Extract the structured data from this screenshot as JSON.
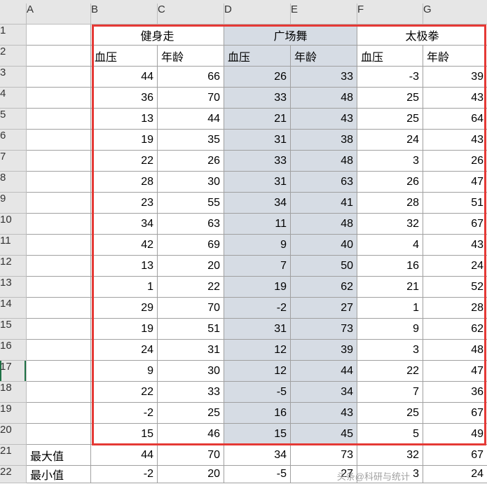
{
  "columns": [
    "A",
    "B",
    "C",
    "D",
    "E",
    "F",
    "G"
  ],
  "row_headers": [
    "1",
    "2",
    "3",
    "4",
    "5",
    "6",
    "7",
    "8",
    "9",
    "10",
    "11",
    "12",
    "13",
    "14",
    "15",
    "16",
    "17",
    "18",
    "19",
    "20",
    "21",
    "22"
  ],
  "groups": [
    {
      "label": "健身走",
      "sub": [
        "血压",
        "年龄"
      ]
    },
    {
      "label": "广场舞",
      "sub": [
        "血压",
        "年龄"
      ]
    },
    {
      "label": "太极拳",
      "sub": [
        "血压",
        "年龄"
      ]
    }
  ],
  "rows": [
    {
      "b": "44",
      "c": "66",
      "d": "26",
      "e": "33",
      "f": "-3",
      "g": "39"
    },
    {
      "b": "36",
      "c": "70",
      "d": "33",
      "e": "48",
      "f": "25",
      "g": "43"
    },
    {
      "b": "13",
      "c": "44",
      "d": "21",
      "e": "43",
      "f": "25",
      "g": "64"
    },
    {
      "b": "19",
      "c": "35",
      "d": "31",
      "e": "38",
      "f": "24",
      "g": "43"
    },
    {
      "b": "22",
      "c": "26",
      "d": "33",
      "e": "48",
      "f": "3",
      "g": "26"
    },
    {
      "b": "28",
      "c": "30",
      "d": "31",
      "e": "63",
      "f": "26",
      "g": "47"
    },
    {
      "b": "23",
      "c": "55",
      "d": "34",
      "e": "41",
      "f": "28",
      "g": "51"
    },
    {
      "b": "34",
      "c": "63",
      "d": "11",
      "e": "48",
      "f": "32",
      "g": "67"
    },
    {
      "b": "42",
      "c": "69",
      "d": "9",
      "e": "40",
      "f": "4",
      "g": "43"
    },
    {
      "b": "13",
      "c": "20",
      "d": "7",
      "e": "50",
      "f": "16",
      "g": "24"
    },
    {
      "b": "1",
      "c": "22",
      "d": "19",
      "e": "62",
      "f": "21",
      "g": "52"
    },
    {
      "b": "29",
      "c": "70",
      "d": "-2",
      "e": "27",
      "f": "1",
      "g": "28"
    },
    {
      "b": "19",
      "c": "51",
      "d": "31",
      "e": "73",
      "f": "9",
      "g": "62"
    },
    {
      "b": "24",
      "c": "31",
      "d": "12",
      "e": "39",
      "f": "3",
      "g": "48"
    },
    {
      "b": "9",
      "c": "30",
      "d": "12",
      "e": "44",
      "f": "22",
      "g": "47"
    },
    {
      "b": "22",
      "c": "33",
      "d": "-5",
      "e": "34",
      "f": "7",
      "g": "36"
    },
    {
      "b": "-2",
      "c": "25",
      "d": "16",
      "e": "43",
      "f": "25",
      "g": "67"
    },
    {
      "b": "15",
      "c": "46",
      "d": "15",
      "e": "45",
      "f": "5",
      "g": "49"
    }
  ],
  "summary": [
    {
      "label": "最大值",
      "b": "44",
      "c": "70",
      "d": "34",
      "e": "73",
      "f": "32",
      "g": "67"
    },
    {
      "label": "最小值",
      "b": "-2",
      "c": "20",
      "d": "-5",
      "e": "27",
      "f": "3",
      "g": "24"
    }
  ],
  "watermark": "头条@科研与统计",
  "chart_data": {
    "type": "table",
    "title": "",
    "series": [
      {
        "name": "健身走-血压",
        "values": [
          44,
          36,
          13,
          19,
          22,
          28,
          23,
          34,
          42,
          13,
          1,
          29,
          19,
          24,
          9,
          22,
          -2,
          15
        ]
      },
      {
        "name": "健身走-年龄",
        "values": [
          66,
          70,
          44,
          35,
          26,
          30,
          55,
          63,
          69,
          20,
          22,
          70,
          51,
          31,
          30,
          33,
          25,
          46
        ]
      },
      {
        "name": "广场舞-血压",
        "values": [
          26,
          33,
          21,
          31,
          33,
          31,
          34,
          11,
          9,
          7,
          19,
          -2,
          31,
          12,
          12,
          -5,
          16,
          15
        ]
      },
      {
        "name": "广场舞-年龄",
        "values": [
          33,
          48,
          43,
          38,
          48,
          63,
          41,
          48,
          40,
          50,
          62,
          27,
          73,
          39,
          44,
          34,
          43,
          45
        ]
      },
      {
        "name": "太极拳-血压",
        "values": [
          -3,
          25,
          25,
          24,
          3,
          26,
          28,
          32,
          4,
          16,
          21,
          1,
          9,
          3,
          22,
          7,
          25,
          5
        ]
      },
      {
        "name": "太极拳-年龄",
        "values": [
          39,
          43,
          64,
          43,
          26,
          47,
          51,
          67,
          43,
          24,
          52,
          28,
          62,
          48,
          47,
          36,
          67,
          49
        ]
      }
    ],
    "summary": {
      "最大值": {
        "B": 44,
        "C": 70,
        "D": 34,
        "E": 73,
        "F": 32,
        "G": 67
      },
      "最小值": {
        "B": -2,
        "C": 20,
        "D": -5,
        "E": 27,
        "F": 3,
        "G": 24
      }
    }
  }
}
